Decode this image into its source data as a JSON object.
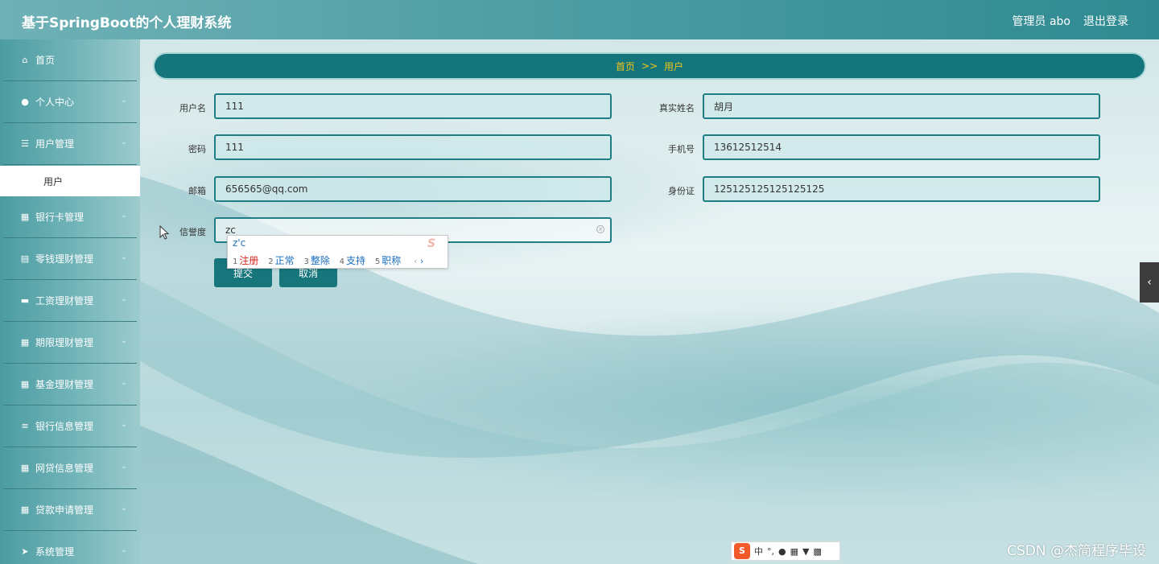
{
  "header": {
    "title": "基于SpringBoot的个人理财系统",
    "user": "管理员 abo",
    "logout": "退出登录"
  },
  "sidebar": {
    "items": [
      {
        "label": "首页",
        "icon": "home-icon"
      },
      {
        "label": "个人中心",
        "icon": "user-icon"
      },
      {
        "label": "用户管理",
        "icon": "sliders-icon"
      },
      {
        "label": "银行卡管理",
        "icon": "grid-icon"
      },
      {
        "label": "零钱理财管理",
        "icon": "clipboard-icon"
      },
      {
        "label": "工资理财管理",
        "icon": "ticket-icon"
      },
      {
        "label": "期限理财管理",
        "icon": "grid-icon"
      },
      {
        "label": "基金理财管理",
        "icon": "grid-icon"
      },
      {
        "label": "银行信息管理",
        "icon": "list-icon"
      },
      {
        "label": "网贷信息管理",
        "icon": "grid-icon"
      },
      {
        "label": "贷款申请管理",
        "icon": "grid-icon"
      },
      {
        "label": "系统管理",
        "icon": "send-icon"
      }
    ],
    "subitem": "用户"
  },
  "breadcrumb": {
    "home": "首页",
    "sep": ">>",
    "current": "用户"
  },
  "form": {
    "username": {
      "label": "用户名",
      "value": "111"
    },
    "realname": {
      "label": "真实姓名",
      "value": "胡月"
    },
    "password": {
      "label": "密码",
      "value": "111"
    },
    "phone": {
      "label": "手机号",
      "value": "13612512514"
    },
    "email": {
      "label": "邮箱",
      "value": "656565@qq.com"
    },
    "idcard": {
      "label": "身份证",
      "value": "125125125125125125"
    },
    "credit": {
      "label": "信誉度",
      "value": "zc"
    },
    "submit": "提交",
    "cancel": "取消"
  },
  "ime": {
    "composition": "z'c",
    "candidates": [
      {
        "n": "1",
        "text": "注册"
      },
      {
        "n": "2",
        "text": "正常"
      },
      {
        "n": "3",
        "text": "整除"
      },
      {
        "n": "4",
        "text": "支持"
      },
      {
        "n": "5",
        "text": "职称"
      }
    ],
    "status_lang": "中"
  },
  "watermark": "CSDN @杰简程序毕设"
}
